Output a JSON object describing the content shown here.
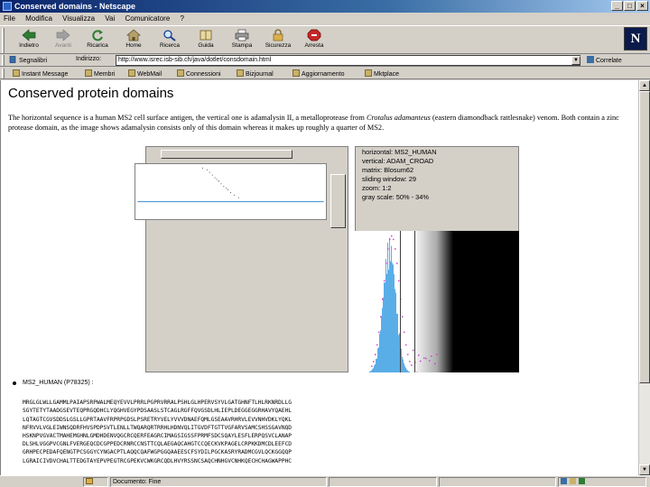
{
  "window": {
    "title": "Conserved domains - Netscape"
  },
  "menu": [
    "File",
    "Modifica",
    "Visualizza",
    "Vai",
    "Comunicatore",
    "?"
  ],
  "toolbar": [
    {
      "label": "Indietro",
      "icon": "back-arrow-icon",
      "enabled": true
    },
    {
      "label": "Avanti",
      "icon": "forward-arrow-icon",
      "enabled": false
    },
    {
      "label": "Ricarica",
      "icon": "reload-icon",
      "enabled": true
    },
    {
      "label": "Home",
      "icon": "home-icon",
      "enabled": true
    },
    {
      "label": "Ricerca",
      "icon": "search-icon",
      "enabled": true
    },
    {
      "label": "Guida",
      "icon": "guide-icon",
      "enabled": true
    },
    {
      "label": "Stampa",
      "icon": "print-icon",
      "enabled": true
    },
    {
      "label": "Sicurezza",
      "icon": "lock-icon",
      "enabled": true
    },
    {
      "label": "Arresta",
      "icon": "stop-icon",
      "enabled": true
    }
  ],
  "location": {
    "bookmarks_label": "Segnalibri",
    "address_label": "Indirizzo:",
    "url": "http://www.isrec.isb-sib.ch/java/dotlet/consdomain.html",
    "related_label": "Correlate"
  },
  "personal_toolbar": [
    "Instant Message",
    "Membri",
    "WebMail",
    "Connessioni",
    "Bizjournal",
    "Aggiornamento",
    "Mktplace"
  ],
  "page": {
    "heading": "Conserved protein domains",
    "intro_part1": "The horizontal sequence is a human MS2 cell surface antigen, the vertical one is adamalysin II, a metalloprotease from ",
    "intro_species": "Crotalus adamanteus",
    "intro_part2": " (eastern diamondback rattlesnake) venom. Both contain a zinc protease domain, as the image shows adamalysin consists only of this domain whereas it makes up roughly a quarter of MS2."
  },
  "applet": {
    "params": [
      "horizontal: MS2_HUMAN",
      "vertical: ADAM_CROAD",
      "matrix: Blosum62",
      "sliding window: 29",
      "zoom: 1:2",
      "gray scale: 50% - 34%"
    ],
    "histogram": {
      "accent": "#5aaee8",
      "curve": "#cc44cc"
    }
  },
  "sequence": {
    "header": "MS2_HUMAN (P78325) :",
    "lines": [
      "MRGLGLWLLGAMMLPAIAPSRPWALMEQYEVVLPRRLPGPRVRRALPSHLGLHPERVSYVLGATGHNFTLHLRKNRDLLG",
      "SGYTETYTAADGSEVTEQPRGQDHCLYQGHVEGYPDSAASLSTCAGLRGFFQVGSDLHLIEPLDEGGEGGRHAVYQAEHL",
      "LQTAGTCGVSDDSLGSLLGPRTAAVFRPRPGDSLPSRETRYVELYVVVDNAEFQMLGSEAAVRHRVLEVVNHVDKLYQKL",
      "NFRVVLVGLEIWNSQDRFHVSPDPSVTLENLLTWQARQRTRRHLHDNVQLITGVDFTGTTVGFARVSAMCSHSSGAVNQD",
      "HSKNPVGVACTMAHEMGHNLGMDHDENVQGCRCQERFEAGRCIMAGSIGSSFPRMFSDCSQAYLESFLERPQSVCLANAP",
      "DLSHLVGGPVCGNLFVERGEQCDCGPPEDCRNRCCNSTTCQLAEGAQCAHGTCCQECKVKPAGELCRPKKDMCDLEEFCD",
      "GRHPECPEDAFQENGTPCSGGYCYNGACPTLAQQCQAFWGPGGQAAEESCFSYDILPGCKASRYRADMCGVLQCKGGQQP",
      "LGRAICIVDVCHALTTEDGTAYEPVPEGTRCGPEKVCWKGRCQDLHVYRSSNCSAQCHNHGVCNHKQECHCHAGWAPPHC"
    ]
  },
  "status": {
    "text": "Documento: Fine"
  }
}
